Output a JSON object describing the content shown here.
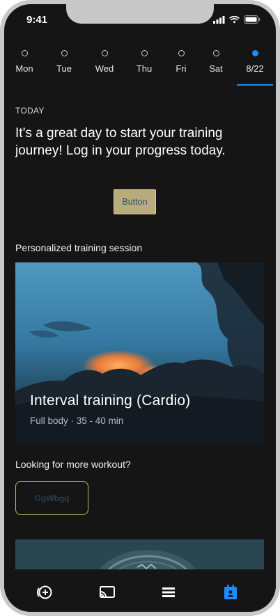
{
  "status_bar": {
    "time": "9:41"
  },
  "days": [
    {
      "label": "Mon",
      "active": false
    },
    {
      "label": "Tue",
      "active": false
    },
    {
      "label": "Wed",
      "active": false
    },
    {
      "label": "Thu",
      "active": false
    },
    {
      "label": "Fri",
      "active": false
    },
    {
      "label": "Sat",
      "active": false
    },
    {
      "label": "8/22",
      "active": true
    }
  ],
  "today_label": "TODAY",
  "headline": "It’s a great day to start your training journey! Log in your progress today.",
  "cta_button": "Button",
  "section_label": "Personalized training session",
  "card": {
    "title": "Interval training (Cardio)",
    "subtitle": "Full body · 35 - 40 min"
  },
  "more_label": "Looking for more workout?",
  "outline_button": "GgWbgq",
  "tabs": [
    {
      "icon": "add-circle-icon"
    },
    {
      "icon": "cast-icon"
    },
    {
      "icon": "list-icon"
    },
    {
      "icon": "calendar-icon",
      "active": true
    }
  ],
  "colors": {
    "accent": "#1e8cff",
    "button_bg": "#b8ab7c",
    "outline": "#a3c56d",
    "background": "#151515"
  }
}
